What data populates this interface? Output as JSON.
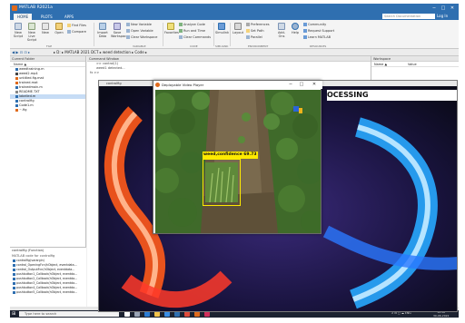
{
  "window": {
    "title": "MATLAB R2021a",
    "minimize": "─",
    "maximize": "□",
    "close": "✕"
  },
  "ribbon_tabs": [
    {
      "label": "HOME",
      "active": true
    },
    {
      "label": "PLOTS",
      "active": false
    },
    {
      "label": "APPS",
      "active": false
    }
  ],
  "search_docs": {
    "placeholder": "Search Documentation"
  },
  "user": {
    "name": "Log In"
  },
  "ribbon": {
    "buttons": [
      {
        "label": "New Script"
      },
      {
        "label": "New Live Script"
      },
      {
        "label": "New"
      },
      {
        "label": "Open"
      },
      {
        "label": "Compare"
      },
      {
        "label": "Import Data"
      },
      {
        "label": "Save Workspace"
      }
    ],
    "variable": {
      "new": "New Variable",
      "open": "Open Variable",
      "clear": "Clear Workspace"
    },
    "favorites": "Favorites",
    "code": {
      "analyze": "Analyze Code",
      "run_time": "Run and Time",
      "clear_cmds": "Clear Commands"
    },
    "simulink": "Simulink",
    "layout": "Layout",
    "env": {
      "preferences": "Preferences",
      "set_path": "Set Path",
      "parallel": "Parallel"
    },
    "addons": "Add-Ons",
    "help": "Help",
    "resources": {
      "community": "Community",
      "support": "Request Support",
      "learn": "Learn MATLAB"
    },
    "sections": {
      "file": "FILE",
      "variable": "VARIABLE",
      "code": "CODE",
      "simulink": "SIMULINK",
      "environment": "ENVIRONMENT",
      "resources": "RESOURCES"
    }
  },
  "address_bar": {
    "nav_icons": "◀ ▶ ⊡ ⊡ ▸",
    "path": "▸ D: ▸ MATLAB 2021 DCT ▸ weed detection ▸ Code ▸"
  },
  "current_folder": {
    "title": "Current Folder",
    "column": "Name ▲",
    "files": [
      {
        "name": "weedtraining.m",
        "selected": false,
        "color": "#2f6fb0"
      },
      {
        "name": "weed2.mp4",
        "selected": false,
        "color": "#444"
      },
      {
        "name": "untitled.fig.mat",
        "selected": false,
        "color": "#e06a1c"
      },
      {
        "name": "trained.mat",
        "selected": false,
        "color": "#e06a1c"
      },
      {
        "name": "trainedmain.m",
        "selected": false,
        "color": "#2f6fb0"
      },
      {
        "name": "README.TXT",
        "selected": false,
        "color": "#888"
      },
      {
        "name": "labelled.m",
        "selected": true,
        "color": "#2f6fb0"
      },
      {
        "name": "controlfig",
        "selected": false,
        "color": "#2f6fb0"
      },
      {
        "name": "Code1.m",
        "selected": false,
        "color": "#2f6fb0"
      },
      {
        "name": "~.fig",
        "selected": false,
        "color": "#e06a1c"
      }
    ]
  },
  "details": {
    "title": "controlfig  (Function)",
    "func": "MATLAB code for controlfig",
    "items": [
      "controlfig(varargin)",
      "control_OpeningFcn(hObject, eventdata...",
      "control_OutputFcn(hObject, eventdata...",
      "pushbutton1_Callback(hObject, eventda...",
      "pushbutton2_Callback(hObject, eventda...",
      "pushbutton3_Callback(hObject, eventda...",
      "pushbutton4_Callback(hObject, eventda...",
      "pushbutton5_Callback(hObject, eventda..."
    ]
  },
  "command_window": {
    "title": "Command Window",
    "lines": [
      ">> control(1)",
      "weed1  detected..."
    ],
    "prompt": "fx >>"
  },
  "workspace": {
    "title": "Workspace",
    "col_name": "Name ▲",
    "col_value": "Value"
  },
  "figure": {
    "title": "controlfig",
    "banner": "OCESSING"
  },
  "video_player": {
    "title": "Deployable Video Player",
    "minimize": "─",
    "maximize": "□",
    "close": "✕"
  },
  "detection": {
    "label": "weed,confidence 69.73",
    "confidence": 69.73,
    "class": "weed"
  },
  "taskbar": {
    "start": "⊞",
    "search_placeholder": "Type here to search",
    "tray": "∧ ⊡ ◻ ☁ ENG",
    "time": "18:26",
    "date": "30-06-2022"
  },
  "colors": {
    "matlab_blue": "#2f6fb0",
    "box_yellow": "#ffea00",
    "taskbar": "#1c2230"
  }
}
